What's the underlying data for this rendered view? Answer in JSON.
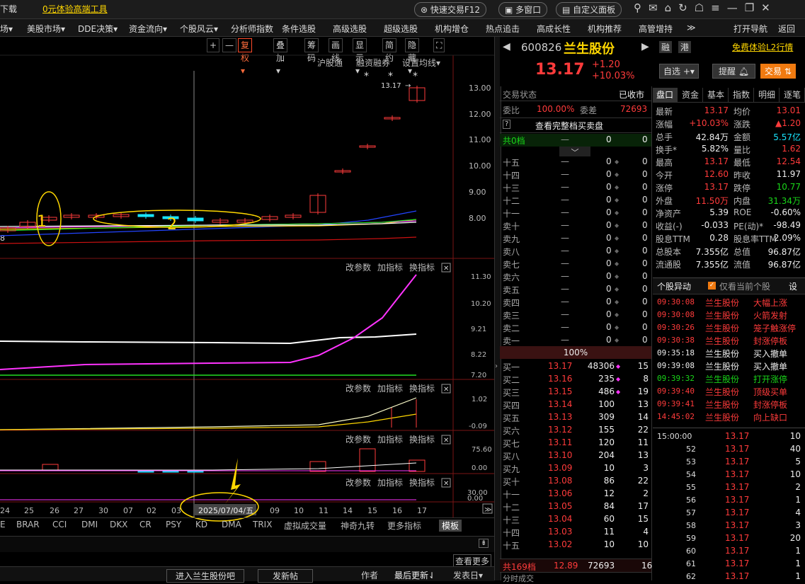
{
  "titlebar": {
    "left_fragment": "下载",
    "promo_link": "0元体验高端工具",
    "quick_trade": "快速交易F12",
    "multi_window": "多窗口",
    "custom_panel": "自定义面板"
  },
  "menu": [
    "场▾",
    "美股市场▾",
    "DDE决策▾",
    "资金流向▾",
    "个股风云▾",
    "分析师指数",
    "条件选股",
    "高级选股",
    "超级选股",
    "机构增仓",
    "热点追击",
    "高成长性",
    "机构推荐",
    "高管增持",
    "≫"
  ],
  "menu_right": [
    "打开导航",
    "返回"
  ],
  "chart": {
    "toolbar": [
      "+",
      "—",
      "复权▾",
      "叠加▾",
      "筹码",
      "画线",
      "显示▾",
      "简约",
      "隐藏▾",
      "⛶"
    ],
    "sub_toolbar": [
      "沪股通",
      "融资融券",
      "设置均线▾"
    ],
    "price_label": "13.17",
    "price_axis": [
      "13.00",
      "12.00",
      "11.00",
      "10.00",
      "9.00",
      "8.00"
    ],
    "left_value": "8",
    "annot1": "1",
    "annot2": "2",
    "panel_ctrls": [
      "改参数",
      "加指标",
      "换指标"
    ],
    "p2_axis": [
      "11.30",
      "10.20",
      "9.21",
      "8.22",
      "7.20"
    ],
    "p3_axis": [
      "1.02",
      "-0.09"
    ],
    "p4_axis": [
      "75.60",
      "0.00"
    ],
    "p5_axis": [
      "30.00",
      "0.00"
    ],
    "dates": [
      "24",
      "25",
      "26",
      "27",
      "30",
      "07",
      "02",
      "03",
      "2025/07/04/五",
      "09",
      "10",
      "11",
      "14",
      "15",
      "16",
      "17"
    ],
    "indicators": [
      "E",
      "BRAR",
      "CCI",
      "DMI",
      "DKX",
      "CR",
      "PSY",
      "KD",
      "DMA",
      "TRIX",
      "虚拟成交量",
      "神奇九转",
      "更多指标",
      "模板"
    ],
    "view_more": "查看更多",
    "bottom_buttons": [
      "进入兰生股份吧",
      "发新帖"
    ],
    "bottom_tabs": [
      "作者",
      "最后更新⇃",
      "发表日▾"
    ]
  },
  "quote": {
    "code": "600826",
    "name": "兰生股份",
    "badges": [
      "融",
      "港"
    ],
    "free_l2": "免费体验L2行情",
    "price": "13.17",
    "change": "+1.20",
    "change_pct": "+10.03%",
    "watch": "自选 +▾",
    "alert": "提醒",
    "trade": "交易"
  },
  "orderbook": {
    "status_label": "交易状态",
    "status_value": "已收市",
    "ratio_label": "委比",
    "ratio_value": "100.00%",
    "diff_label": "委差",
    "diff_value": "72693",
    "full_book": "查看完整档买卖盘",
    "total_levels": "共0档",
    "dash": "—",
    "zero": "0",
    "sell_levels": [
      "十五",
      "十四",
      "十三",
      "十二",
      "十一",
      "卖十",
      "卖九",
      "卖八",
      "卖七",
      "卖六",
      "卖五",
      "卖四",
      "卖三",
      "卖二",
      "卖一"
    ],
    "ratio_bar": "100%",
    "buys": [
      {
        "l": "买一",
        "p": "13.17",
        "v": "48306",
        "n": "15"
      },
      {
        "l": "买二",
        "p": "13.16",
        "v": "235",
        "n": "8"
      },
      {
        "l": "买三",
        "p": "13.15",
        "v": "486",
        "n": "19"
      },
      {
        "l": "买四",
        "p": "13.14",
        "v": "100",
        "n": "13"
      },
      {
        "l": "买五",
        "p": "13.13",
        "v": "309",
        "n": "14"
      },
      {
        "l": "买六",
        "p": "13.12",
        "v": "155",
        "n": "22"
      },
      {
        "l": "买七",
        "p": "13.11",
        "v": "120",
        "n": "11"
      },
      {
        "l": "买八",
        "p": "13.10",
        "v": "204",
        "n": "13"
      },
      {
        "l": "买九",
        "p": "13.09",
        "v": "10",
        "n": "3"
      },
      {
        "l": "买十",
        "p": "13.08",
        "v": "86",
        "n": "22"
      },
      {
        "l": "十一",
        "p": "13.06",
        "v": "12",
        "n": "2"
      },
      {
        "l": "十二",
        "p": "13.05",
        "v": "84",
        "n": "17"
      },
      {
        "l": "十三",
        "p": "13.04",
        "v": "60",
        "n": "15"
      },
      {
        "l": "十四",
        "p": "13.03",
        "v": "11",
        "n": "4"
      },
      {
        "l": "十五",
        "p": "13.02",
        "v": "10",
        "n": "10"
      }
    ],
    "total_buy": {
      "l": "共169档",
      "p": "12.89",
      "v": "72693",
      "n": "16"
    },
    "bottom_label": "分时成交"
  },
  "stats": {
    "tabs": [
      "盘口",
      "资金",
      "基本",
      "指数",
      "明细",
      "逐笔"
    ],
    "rows": [
      [
        "最新",
        "13.17",
        "均价",
        "13.01"
      ],
      [
        "涨幅",
        "+10.03%",
        "涨跌",
        "▲1.20"
      ],
      [
        "总手",
        "42.84万",
        "金额",
        "5.57亿"
      ],
      [
        "换手*",
        "5.82%",
        "量比",
        "1.62"
      ],
      [
        "最高",
        "13.17",
        "最低",
        "12.54"
      ],
      [
        "今开",
        "12.60",
        "昨收",
        "11.97"
      ],
      [
        "涨停",
        "13.17",
        "跌停",
        "10.77"
      ],
      [
        "外盘",
        "11.50万",
        "内盘",
        "31.34万"
      ],
      [
        "净资产",
        "5.39",
        "ROE",
        "-0.60%"
      ],
      [
        "收益(-)",
        "-0.033",
        "PE(动)*",
        "-98.49"
      ],
      [
        "股息TTM",
        "0.28",
        "股息率TTM",
        "2.09%"
      ],
      [
        "总股本",
        "7.355亿",
        "总值",
        "96.87亿"
      ],
      [
        "流通股",
        "7.355亿",
        "流值",
        "96.87亿"
      ]
    ]
  },
  "events": {
    "title": "个股异动",
    "filter": "仅看当前个股",
    "settings": "设",
    "rows": [
      [
        "09:30:08",
        "兰生股份",
        "大幅上涨"
      ],
      [
        "09:30:08",
        "兰生股份",
        "火箭发射"
      ],
      [
        "09:30:26",
        "兰生股份",
        "笼子触涨停"
      ],
      [
        "09:30:38",
        "兰生股份",
        "封涨停板"
      ],
      [
        "09:35:18",
        "兰生股份",
        "买入撤单"
      ],
      [
        "09:39:08",
        "兰生股份",
        "买入撤单"
      ],
      [
        "09:39:32",
        "兰生股份",
        "打开涨停"
      ],
      [
        "09:39:40",
        "兰生股份",
        "顶级买单"
      ],
      [
        "09:39:41",
        "兰生股份",
        "封涨停板"
      ],
      [
        "14:45:02",
        "兰生股份",
        "向上缺口"
      ]
    ]
  },
  "ticks": [
    [
      "15:00:00",
      "13.17",
      "10"
    ],
    [
      "52",
      "13.17",
      "40"
    ],
    [
      "53",
      "13.17",
      "5"
    ],
    [
      "54",
      "13.17",
      "10"
    ],
    [
      "55",
      "13.17",
      "2"
    ],
    [
      "56",
      "13.17",
      "1"
    ],
    [
      "57",
      "13.17",
      "4"
    ],
    [
      "58",
      "13.17",
      "3"
    ],
    [
      "59",
      "13.17",
      "20"
    ],
    [
      "60",
      "13.17",
      "1"
    ],
    [
      "61",
      "13.17",
      "1"
    ],
    [
      "62",
      "13.17",
      "1"
    ]
  ],
  "colors": {
    "up": "#ff3b3b",
    "down": "#19d619",
    "accent": "#ffd700",
    "bg": "#000000"
  }
}
